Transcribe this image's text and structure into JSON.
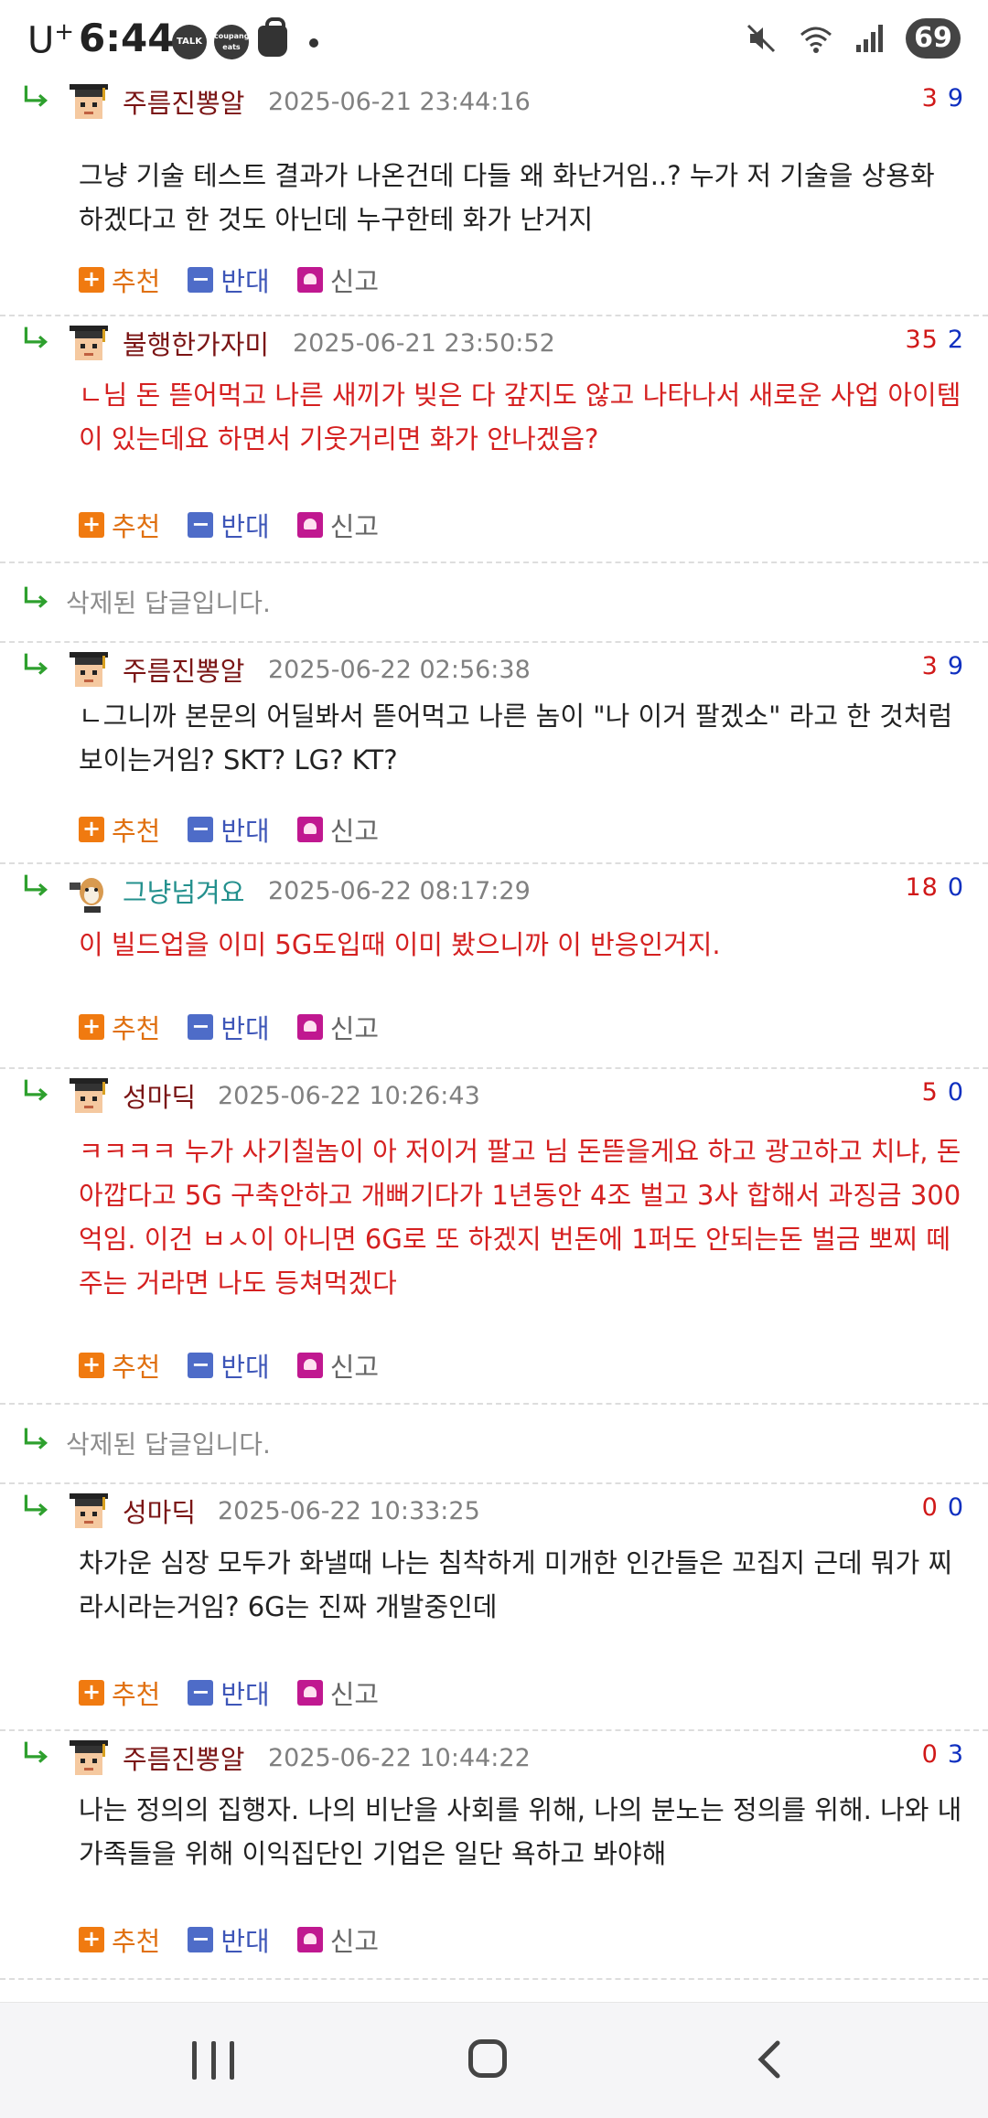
{
  "status_bar": {
    "carrier": "U",
    "carrier_sup": "+",
    "time": "6:44",
    "notif_icons": [
      "TALK",
      "coupang eats"
    ],
    "battery": "69"
  },
  "labels": {
    "recommend": "추천",
    "oppose": "반대",
    "report": "신고",
    "deleted": "삭제된 답글입니다."
  },
  "comments": [
    {
      "nick": "주름진뽕알",
      "date": "2025-06-21 23:44:16",
      "up": "3",
      "down": "9",
      "text": "그냥 기술 테스트 결과가 나온건데 다들 왜 화난거임..? 누가 저 기술을 상용화 하겠다고 한 것도 아닌데 누구한테 화가 난거지"
    },
    {
      "nick": "불행한가자미",
      "date": "2025-06-21 23:50:52",
      "up": "35",
      "down": "2",
      "text": "ㄴ님 돈 뜯어먹고 나른 새끼가 빚은 다 갚지도 않고 나타나서 새로운 사업 아이템이 있는데요 하면서 기웃거리면 화가 안나겠음?"
    },
    {
      "nick": "주름진뽕알",
      "date": "2025-06-22 02:56:38",
      "up": "3",
      "down": "9",
      "text": "ㄴ그니까 본문의 어딜봐서 뜯어먹고 나른 놈이 \"나 이거 팔겠소\" 라고 한 것처럼 보이는거임? SKT? LG? KT?"
    },
    {
      "nick": "그냥넘겨요",
      "date": "2025-06-22 08:17:29",
      "up": "18",
      "down": "0",
      "text": "이 빌드업을 이미 5G도입때 이미 봤으니까 이 반응인거지."
    },
    {
      "nick": "성마딕",
      "date": "2025-06-22 10:26:43",
      "up": "5",
      "down": "0",
      "text": "ㅋㅋㅋㅋ 누가 사기칠놈이 아 저이거 팔고 님 돈뜯을게요 하고 광고하고 치냐, 돈아깝다고 5G 구축안하고 개뻐기다가 1년동안 4조 벌고 3사 합해서 과징금 300억임. 이건 ㅂㅅ이 아니면 6G로 또 하겠지 번돈에 1퍼도 안되는돈 벌금 뽀찌 떼주는 거라면 나도 등쳐먹겠다"
    },
    {
      "nick": "성마딕",
      "date": "2025-06-22 10:33:25",
      "up": "0",
      "down": "0",
      "text": "차가운 심장 모두가 화낼때 나는 침착하게 미개한 인간들은 꼬집지 근데 뭐가 찌라시라는거임? 6G는 진짜 개발중인데"
    },
    {
      "nick": "주름진뽕알",
      "date": "2025-06-22 10:44:22",
      "up": "0",
      "down": "3",
      "text": "나는 정의의 집행자. 나의 비난을 사회를 위해, 나의 분노는 정의를 위해. 나와 내 가족들을 위해 이익집단인 기업은 일단 욕하고 봐야해"
    }
  ]
}
